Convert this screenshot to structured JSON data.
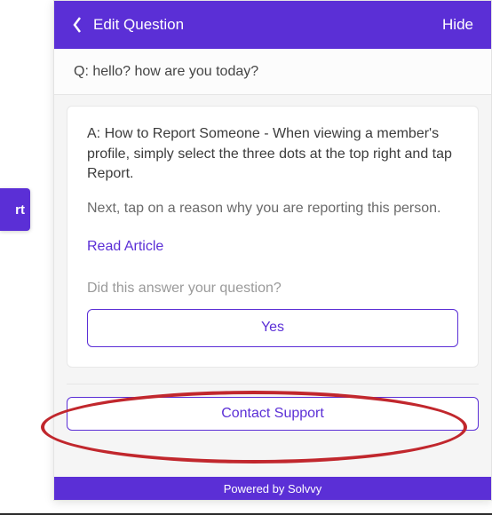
{
  "side_button": {
    "label": "rt"
  },
  "header": {
    "title": "Edit Question",
    "hide": "Hide"
  },
  "question": {
    "text": "Q: hello? how are you today?"
  },
  "answer": {
    "p1": "A: How to Report Someone - When viewing a member's profile, simply select the three dots at the top right and tap Report.",
    "p2": "Next, tap on a reason why you are reporting this person.",
    "read_article": "Read Article",
    "feedback_prompt": "Did this answer your question?",
    "yes": "Yes"
  },
  "contact": {
    "label": "Contact Support"
  },
  "footer": {
    "text": "Powered by Solvvy"
  }
}
